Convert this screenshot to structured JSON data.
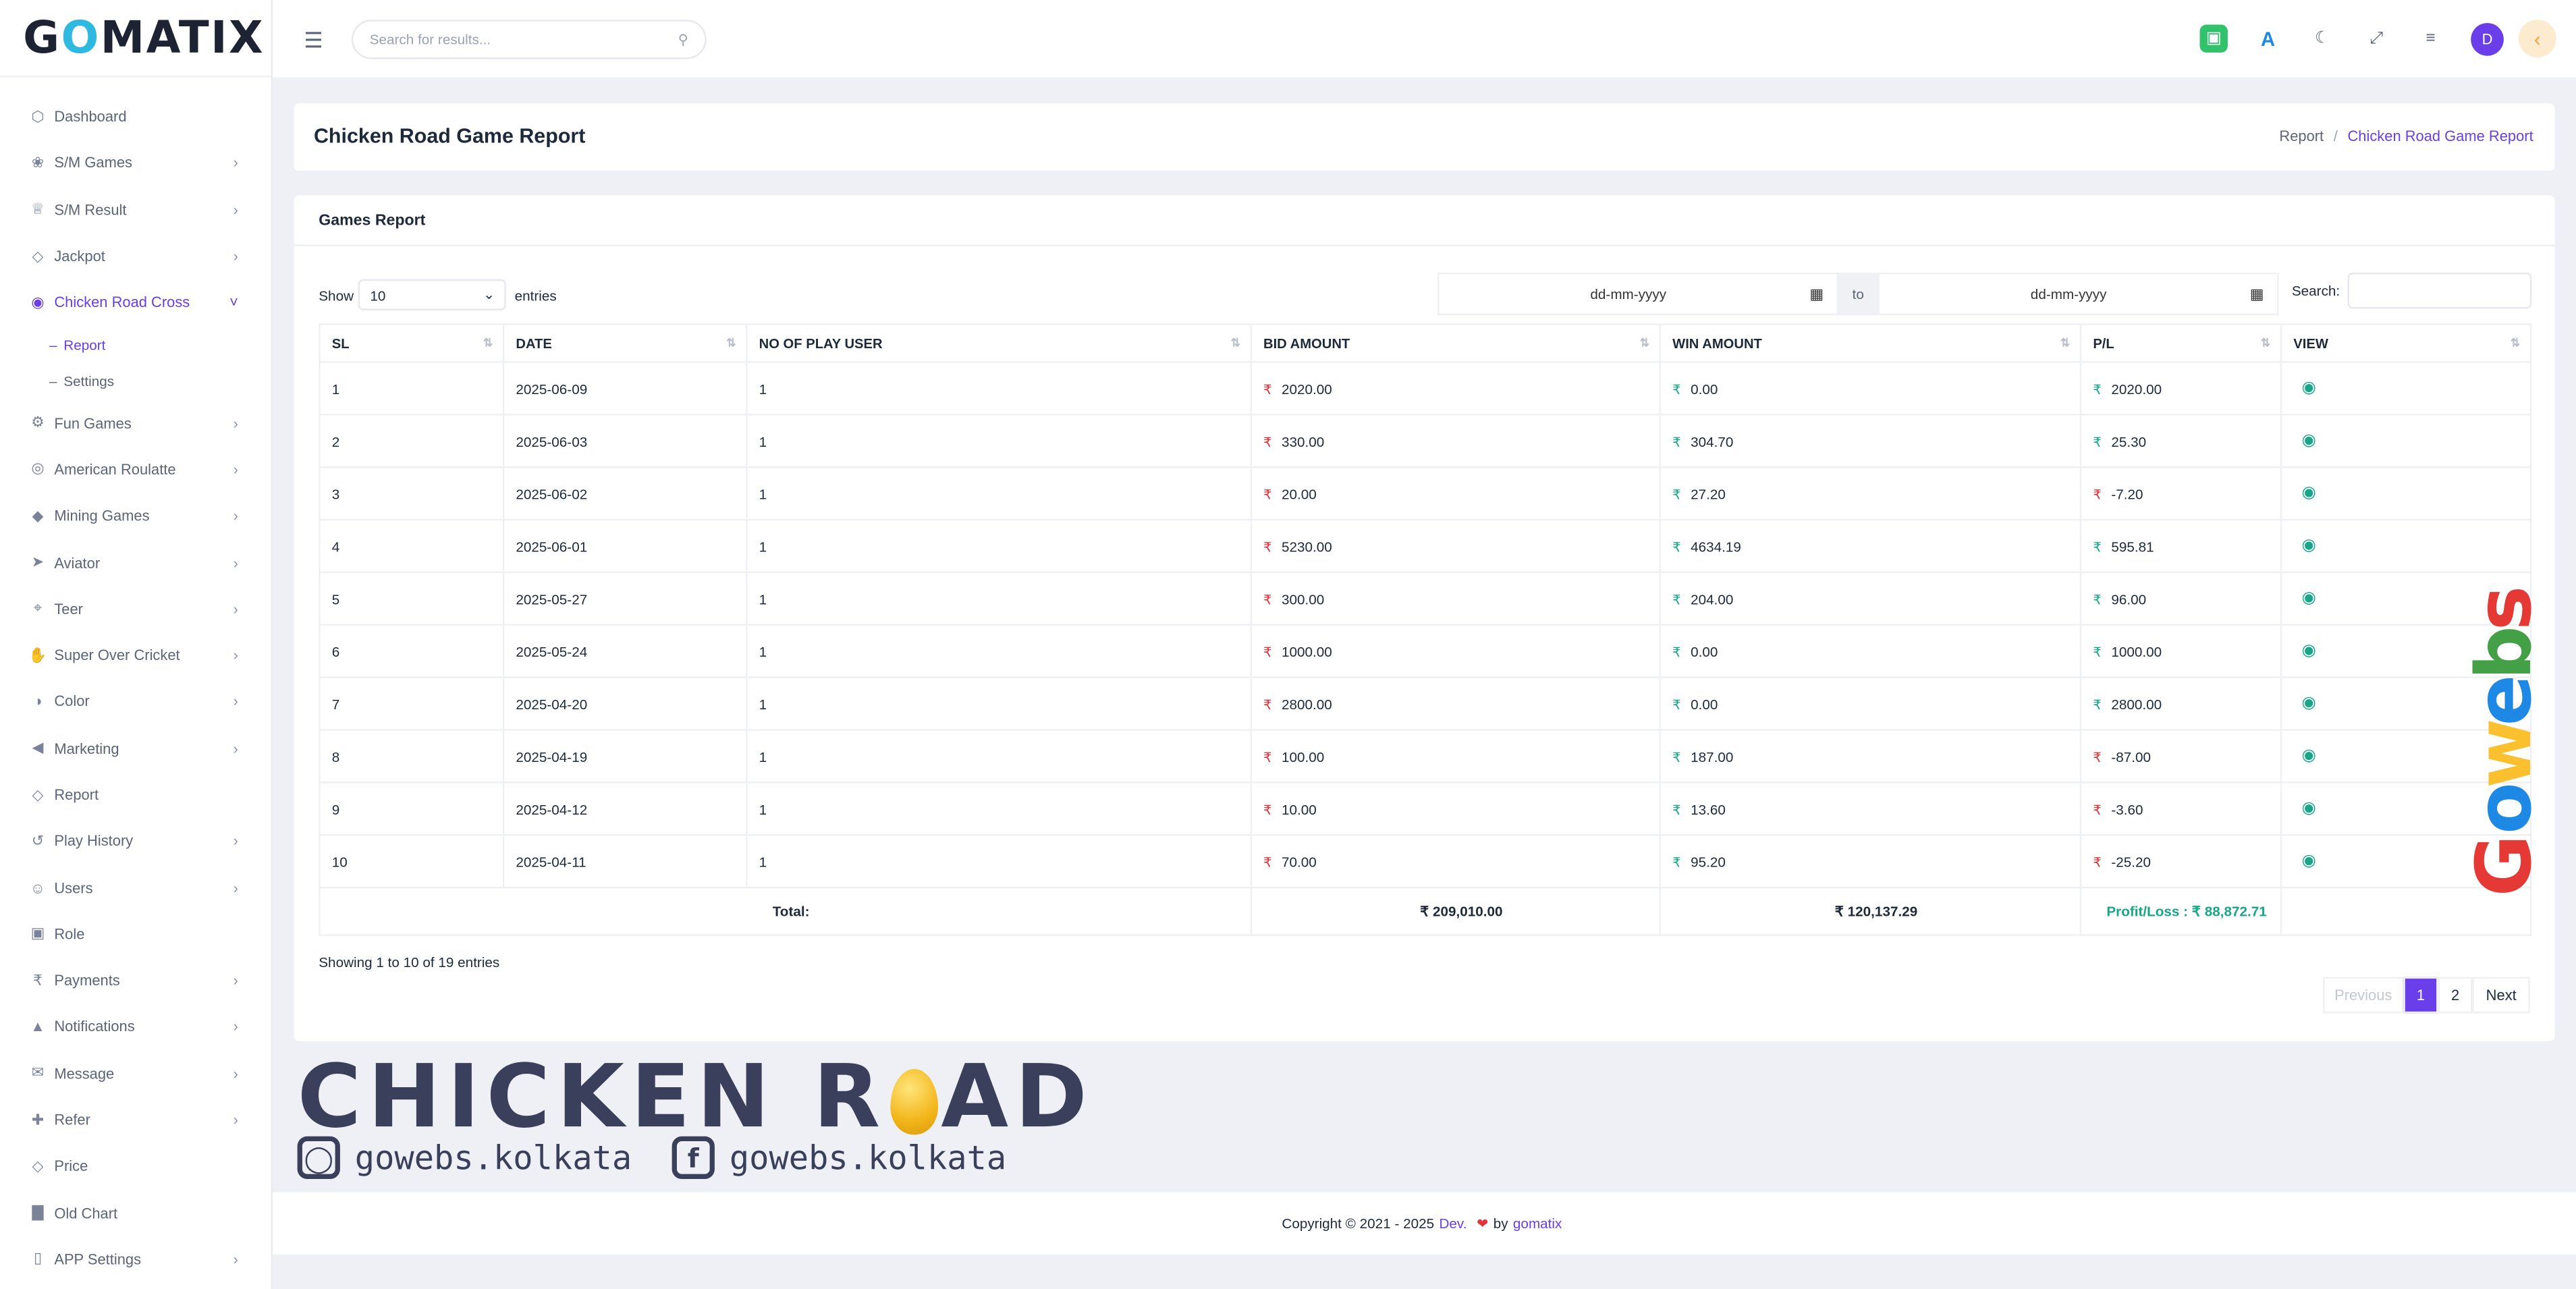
{
  "brand": {
    "logo_text": "GOMATIX"
  },
  "sidebar": {
    "items": [
      {
        "label": "Dashboard",
        "icon": "cube-icon",
        "has_children": false
      },
      {
        "label": "S/M Games",
        "icon": "palette-icon",
        "has_children": true
      },
      {
        "label": "S/M Result",
        "icon": "trophy-icon",
        "has_children": true
      },
      {
        "label": "Jackpot",
        "icon": "tag-icon",
        "has_children": true
      },
      {
        "label": "Chicken Road Cross",
        "icon": "target-icon",
        "has_children": true,
        "active": true,
        "children": [
          {
            "label": "Report",
            "active": true
          },
          {
            "label": "Settings"
          }
        ]
      },
      {
        "label": "Fun Games",
        "icon": "gear-icon",
        "has_children": true
      },
      {
        "label": "American Roulatte",
        "icon": "globe-icon",
        "has_children": true
      },
      {
        "label": "Mining Games",
        "icon": "diamond-icon",
        "has_children": true
      },
      {
        "label": "Aviator",
        "icon": "rocket-icon",
        "has_children": true
      },
      {
        "label": "Teer",
        "icon": "crosshair-icon",
        "has_children": true
      },
      {
        "label": "Super Over Cricket",
        "icon": "hand-icon",
        "has_children": true
      },
      {
        "label": "Color",
        "icon": "contrast-icon",
        "has_children": true
      },
      {
        "label": "Marketing",
        "icon": "megaphone-icon",
        "has_children": true
      },
      {
        "label": "Report",
        "icon": "tag-icon",
        "has_children": false
      },
      {
        "label": "Play History",
        "icon": "history-icon",
        "has_children": true
      },
      {
        "label": "Users",
        "icon": "users-icon",
        "has_children": true
      },
      {
        "label": "Role",
        "icon": "lock-icon",
        "has_children": false
      },
      {
        "label": "Payments",
        "icon": "rupee-icon",
        "has_children": true
      },
      {
        "label": "Notifications",
        "icon": "bell-icon",
        "has_children": true
      },
      {
        "label": "Message",
        "icon": "envelope-icon",
        "has_children": true
      },
      {
        "label": "Refer",
        "icon": "user-plus-icon",
        "has_children": true
      },
      {
        "label": "Price",
        "icon": "tag-icon",
        "has_children": false
      },
      {
        "label": "Old Chart",
        "icon": "chart-icon",
        "has_children": false
      },
      {
        "label": "APP Settings",
        "icon": "mobile-icon",
        "has_children": true
      }
    ]
  },
  "topbar": {
    "search_placeholder": "Search for results...",
    "avatar_initial": "D"
  },
  "page": {
    "title": "Chicken Road Game Report",
    "breadcrumb": [
      "Report",
      "Chicken Road Game Report"
    ]
  },
  "card": {
    "title": "Games Report",
    "show_label": "Show",
    "entries_value": "10",
    "entries_label": "entries",
    "date_from_placeholder": "dd-mm-yyyy",
    "date_to_placeholder": "dd-mm-yyyy",
    "to_label": "to",
    "search_label": "Search:"
  },
  "table": {
    "columns": [
      "SL",
      "DATE",
      "NO OF PLAY USER",
      "BID AMOUNT",
      "WIN AMOUNT",
      "P/L",
      "VIEW"
    ],
    "currency_symbol": "₹",
    "rows": [
      {
        "sl": "1",
        "date": "2025-06-09",
        "users": "1",
        "bid": "2020.00",
        "win": "0.00",
        "pl": "2020.00",
        "pl_negative": false
      },
      {
        "sl": "2",
        "date": "2025-06-03",
        "users": "1",
        "bid": "330.00",
        "win": "304.70",
        "pl": "25.30",
        "pl_negative": false
      },
      {
        "sl": "3",
        "date": "2025-06-02",
        "users": "1",
        "bid": "20.00",
        "win": "27.20",
        "pl": "-7.20",
        "pl_negative": true
      },
      {
        "sl": "4",
        "date": "2025-06-01",
        "users": "1",
        "bid": "5230.00",
        "win": "4634.19",
        "pl": "595.81",
        "pl_negative": false
      },
      {
        "sl": "5",
        "date": "2025-05-27",
        "users": "1",
        "bid": "300.00",
        "win": "204.00",
        "pl": "96.00",
        "pl_negative": false
      },
      {
        "sl": "6",
        "date": "2025-05-24",
        "users": "1",
        "bid": "1000.00",
        "win": "0.00",
        "pl": "1000.00",
        "pl_negative": false
      },
      {
        "sl": "7",
        "date": "2025-04-20",
        "users": "1",
        "bid": "2800.00",
        "win": "0.00",
        "pl": "2800.00",
        "pl_negative": false
      },
      {
        "sl": "8",
        "date": "2025-04-19",
        "users": "1",
        "bid": "100.00",
        "win": "187.00",
        "pl": "-87.00",
        "pl_negative": true
      },
      {
        "sl": "9",
        "date": "2025-04-12",
        "users": "1",
        "bid": "10.00",
        "win": "13.60",
        "pl": "-3.60",
        "pl_negative": true
      },
      {
        "sl": "10",
        "date": "2025-04-11",
        "users": "1",
        "bid": "70.00",
        "win": "95.20",
        "pl": "-25.20",
        "pl_negative": true
      }
    ],
    "total_label": "Total:",
    "total_bid": "₹ 209,010.00",
    "total_win": "₹ 120,137.29",
    "total_pl": "Profit/Loss : ₹ 88,872.71"
  },
  "pagination": {
    "info": "Showing 1 to 10 of 19 entries",
    "previous": "Previous",
    "pages": [
      "1",
      "2"
    ],
    "next": "Next"
  },
  "banner": {
    "title_part1": "CHICKEN R",
    "title_part2": "AD",
    "instagram": "gowebs.kolkata",
    "facebook": "gowebs.kolkata"
  },
  "watermark": {
    "text": "Gowebs"
  },
  "footer": {
    "copyright": "Copyright © 2021 - 2025",
    "dev_link": "Dev.",
    "by": "by",
    "company": "gomatix"
  },
  "colors": {
    "accent": "#6a3ee8",
    "positive": "#18a689",
    "negative": "#e2333a",
    "banner": "#3a3f5c"
  }
}
